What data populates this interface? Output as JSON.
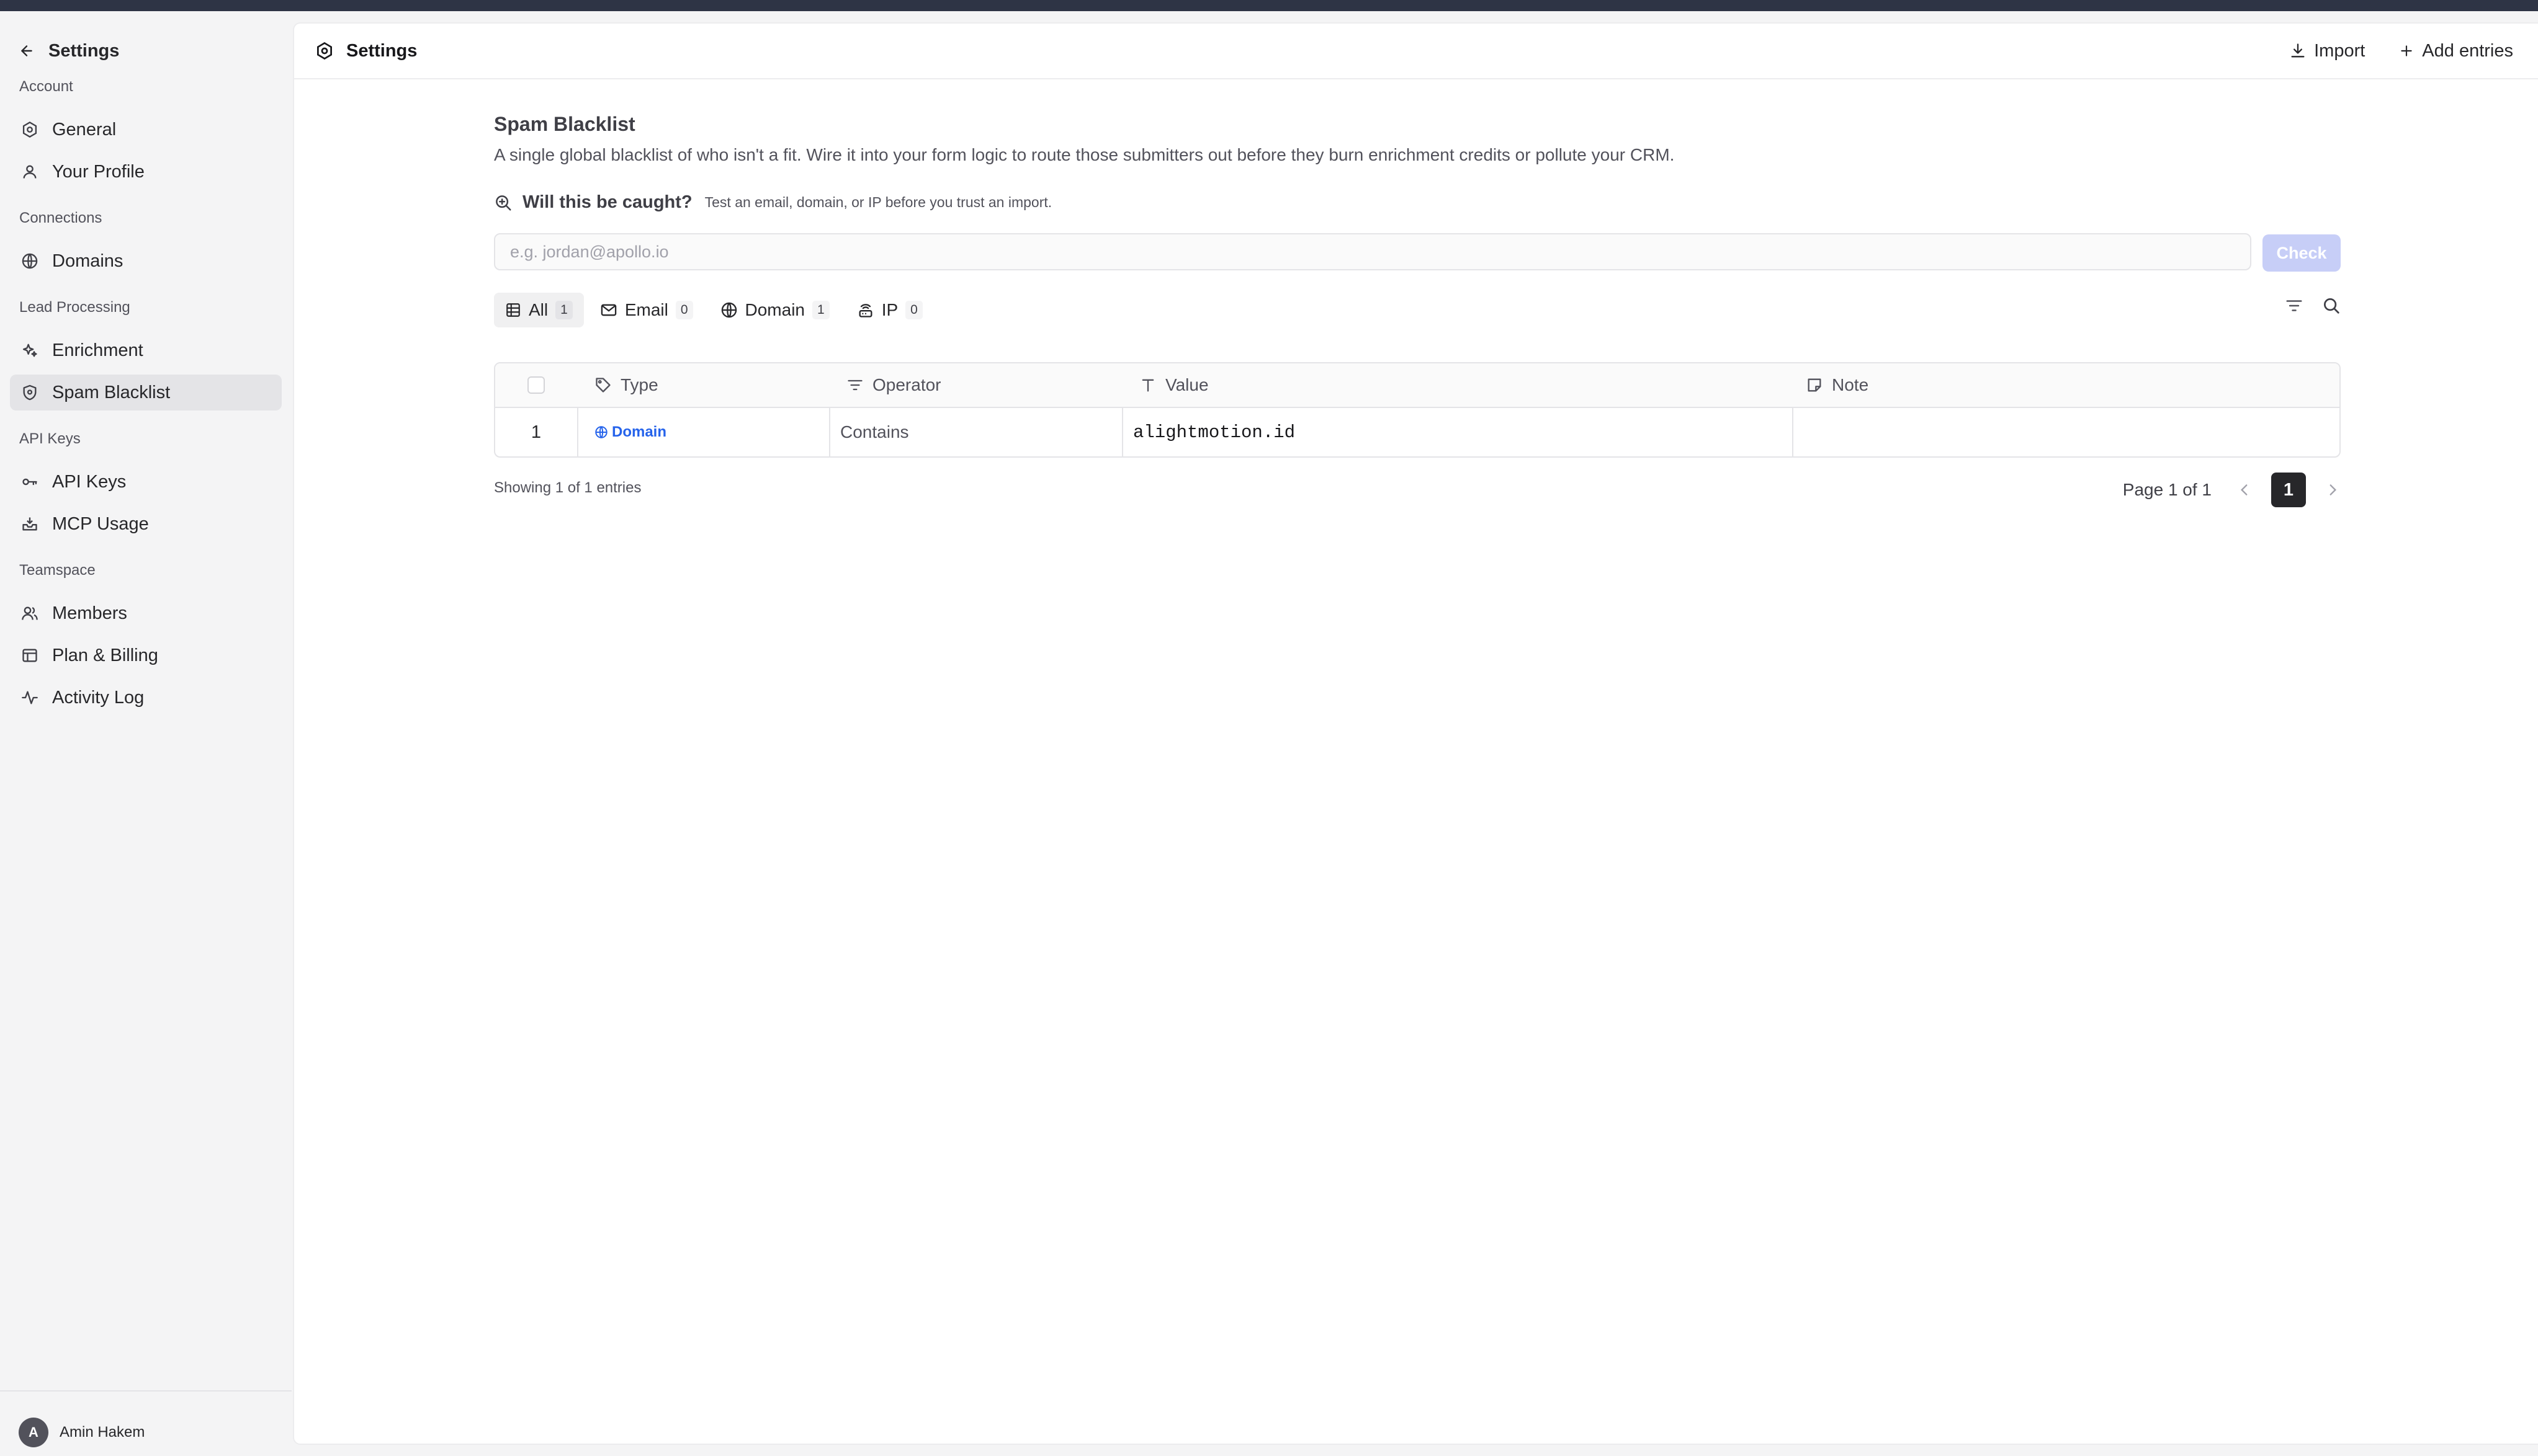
{
  "sidebar": {
    "back_label": "Settings",
    "sections": [
      {
        "title": "Account",
        "items": [
          {
            "label": "General",
            "icon": "gear-icon"
          },
          {
            "label": "Your Profile",
            "icon": "user-icon"
          }
        ]
      },
      {
        "title": "Connections",
        "items": [
          {
            "label": "Domains",
            "icon": "globe-icon"
          }
        ]
      },
      {
        "title": "Lead Processing",
        "items": [
          {
            "label": "Enrichment",
            "icon": "sparkles-icon"
          },
          {
            "label": "Spam Blacklist",
            "icon": "shield-icon",
            "active": true
          }
        ]
      },
      {
        "title": "API Keys",
        "items": [
          {
            "label": "API Keys",
            "icon": "key-icon"
          },
          {
            "label": "MCP Usage",
            "icon": "inbox-icon"
          }
        ]
      },
      {
        "title": "Teamspace",
        "items": [
          {
            "label": "Members",
            "icon": "users-icon"
          },
          {
            "label": "Plan & Billing",
            "icon": "billing-icon"
          },
          {
            "label": "Activity Log",
            "icon": "activity-icon"
          }
        ]
      }
    ],
    "user": {
      "initial": "A",
      "name": "Amin Hakem"
    }
  },
  "header": {
    "title": "Settings",
    "import_label": "Import",
    "add_label": "Add entries"
  },
  "page": {
    "title": "Spam Blacklist",
    "description": "A single global blacklist of who isn't a fit. Wire it into your form logic to route those submitters out before they burn enrichment credits or pollute your CRM.",
    "check": {
      "question": "Will this be caught?",
      "hint": "Test an email, domain, or IP before you trust an import.",
      "placeholder": "e.g. jordan@apollo.io",
      "value": "",
      "button": "Check"
    }
  },
  "tabs": [
    {
      "label": "All",
      "count": "1",
      "icon": "table-icon",
      "active": true
    },
    {
      "label": "Email",
      "count": "0",
      "icon": "mail-icon"
    },
    {
      "label": "Domain",
      "count": "1",
      "icon": "globe-icon"
    },
    {
      "label": "IP",
      "count": "0",
      "icon": "router-icon"
    }
  ],
  "table": {
    "columns": [
      {
        "label": "Type",
        "icon": "tag-icon"
      },
      {
        "label": "Operator",
        "icon": "filter-icon"
      },
      {
        "label": "Value",
        "icon": "text-icon"
      },
      {
        "label": "Note",
        "icon": "note-icon"
      }
    ],
    "rows": [
      {
        "num": "1",
        "type": "Domain",
        "operator": "Contains",
        "value": "alightmotion.id",
        "note": ""
      }
    ]
  },
  "footer": {
    "showing": "Showing 1 of 1 entries",
    "page_label": "Page 1 of 1",
    "current_page": "1"
  },
  "colors": {
    "accent": "#2563eb",
    "check_button": "#c7cef7",
    "topbar": "#2e3445"
  }
}
